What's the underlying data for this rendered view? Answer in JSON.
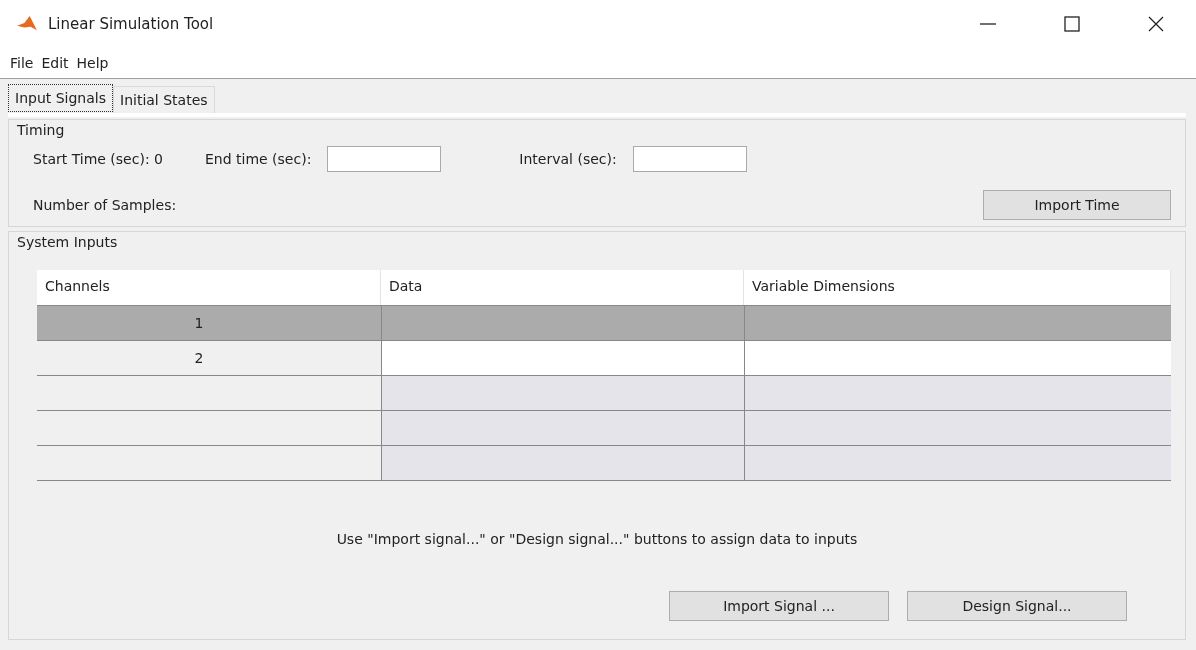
{
  "window": {
    "title": "Linear Simulation Tool"
  },
  "menu": [
    "File",
    "Edit",
    "Help"
  ],
  "tabs": [
    {
      "label": "Input Signals",
      "selected": true
    },
    {
      "label": "Initial States",
      "selected": false
    }
  ],
  "timing": {
    "title": "Timing",
    "start_time": "Start Time (sec): 0",
    "end_time_label": "End time (sec):",
    "interval_label": "Interval (sec):",
    "samples_label": "Number of Samples:",
    "import_button": "Import Time"
  },
  "system_inputs": {
    "title": "System Inputs",
    "columns": [
      "Channels",
      "Data",
      "Variable Dimensions"
    ],
    "rows": [
      {
        "kind": "channel",
        "channel": "1",
        "selected": true
      },
      {
        "kind": "channel",
        "channel": "2",
        "selected": false
      },
      {
        "kind": "empty"
      },
      {
        "kind": "empty"
      },
      {
        "kind": "empty"
      }
    ],
    "hint": "Use \"Import signal...\" or \"Design signal...\" buttons to assign data to inputs",
    "buttons": [
      "Import Signal ...",
      "Design Signal..."
    ]
  }
}
